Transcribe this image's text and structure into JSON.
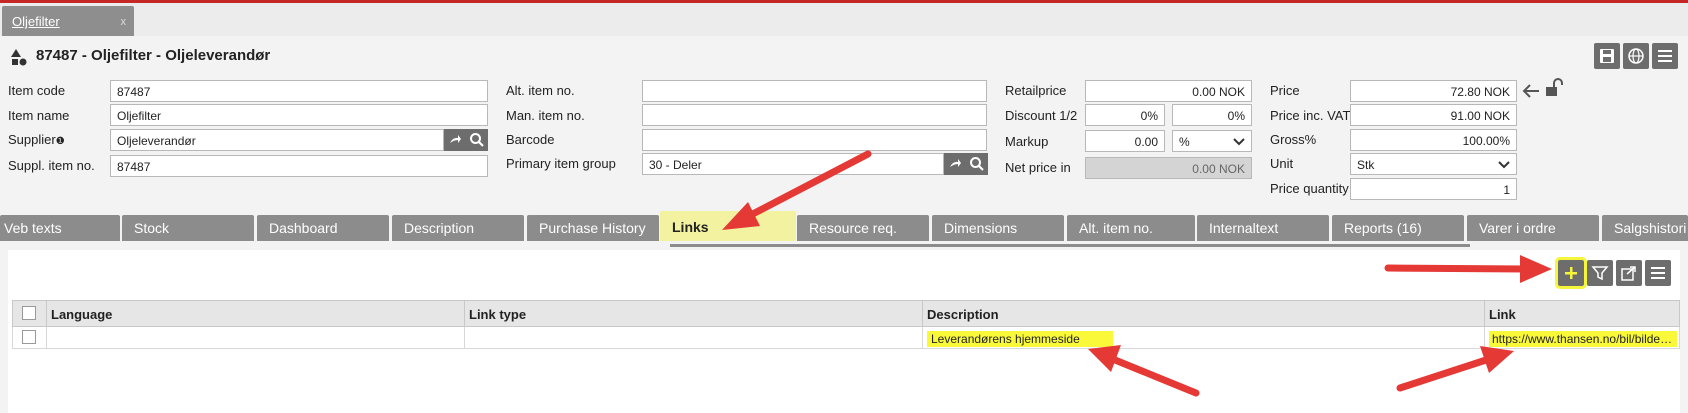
{
  "doc_tab": {
    "label": "Oljefilter",
    "close": "x"
  },
  "header": {
    "title": "87487 - Oljefilter - Oljeleverandør"
  },
  "col1": {
    "item_code_label": "Item code",
    "item_code": "87487",
    "item_name_label": "Item name",
    "item_name": "Oljefilter",
    "supplier_label": "Supplier",
    "supplier_info": "❶",
    "supplier": "Oljeleverandør",
    "suppl_item_label": "Suppl. item no.",
    "suppl_item": "87487"
  },
  "col2": {
    "alt_label": "Alt. item no.",
    "alt": "",
    "man_label": "Man. item no.",
    "man": "",
    "barcode_label": "Barcode",
    "barcode": "",
    "group_label": "Primary item group",
    "group": "30 - Deler"
  },
  "col3": {
    "retail_label": "Retailprice",
    "retail": "0.00 NOK",
    "discount_label": "Discount 1/2",
    "discount1": "0%",
    "discount2": "0%",
    "markup_label": "Markup",
    "markup": "0.00",
    "markup_unit": "%",
    "netprice_label": "Net price in",
    "netprice": "0.00 NOK"
  },
  "col4": {
    "price_label": "Price",
    "price": "72.80 NOK",
    "price_vat_label": "Price inc. VAT",
    "price_vat": "91.00 NOK",
    "gross_label": "Gross%",
    "gross": "100.00%",
    "unit_label": "Unit",
    "unit": "Stk",
    "price_qty_label": "Price quantity",
    "price_qty": "1"
  },
  "tabs": [
    {
      "label": "Veb texts"
    },
    {
      "label": "Stock"
    },
    {
      "label": "Dashboard"
    },
    {
      "label": "Description"
    },
    {
      "label": "Purchase History"
    },
    {
      "label": "Links"
    },
    {
      "label": "Resource req."
    },
    {
      "label": "Dimensions"
    },
    {
      "label": "Alt. item no."
    },
    {
      "label": "Internaltext"
    },
    {
      "label": "Reports (16)"
    },
    {
      "label": "Varer i ordre"
    },
    {
      "label": "Salgshistori"
    }
  ],
  "grid": {
    "columns": [
      "Language",
      "Link type",
      "Description",
      "Link"
    ],
    "rows": [
      {
        "language": "",
        "link_type": "",
        "description": "Leverandørens hjemmeside",
        "link": "https://www.thansen.no/bil/bildeler/..."
      }
    ]
  },
  "colors": {
    "accent": "#6d6d6d",
    "tab": "#8c8c8c",
    "highlight": "#f9f93a",
    "annotation": "#e53935"
  },
  "icons": [
    "shapes-icon",
    "save-icon",
    "globe-icon",
    "menu-icon",
    "arrow-right-icon",
    "search-icon",
    "arrow-left-icon",
    "unlock-icon",
    "plus-icon",
    "filter-icon",
    "export-icon"
  ]
}
